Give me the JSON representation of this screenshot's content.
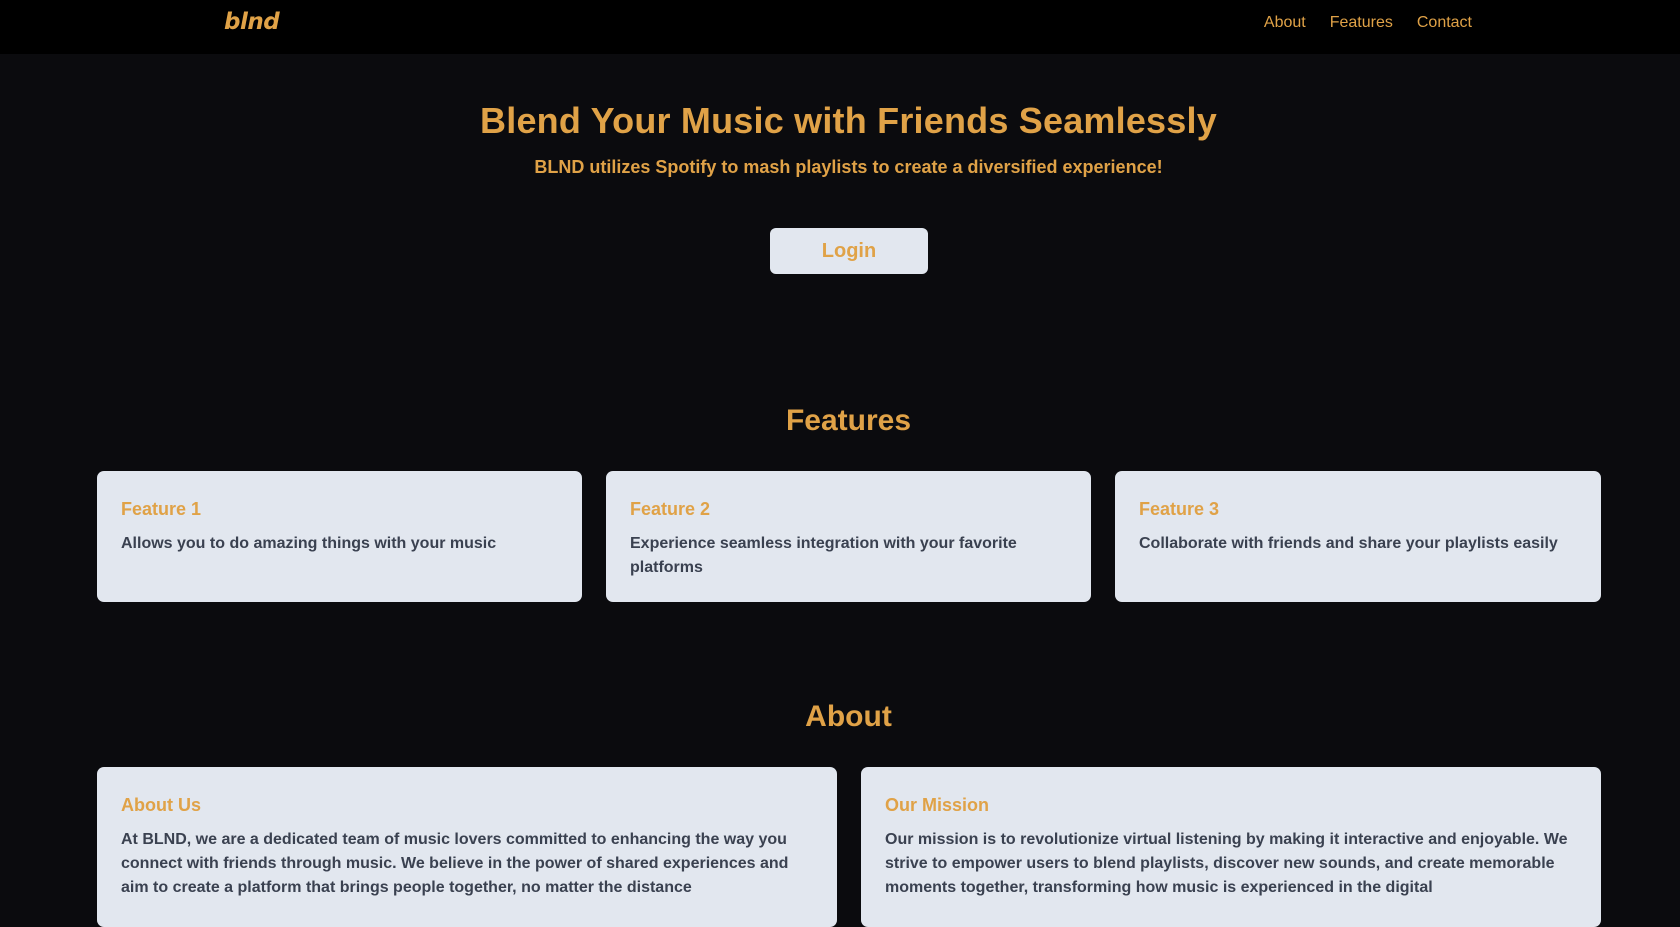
{
  "brand": {
    "logo_text": "blnd",
    "accent_color": "#e0a247"
  },
  "nav": {
    "links": [
      {
        "label": "About"
      },
      {
        "label": "Features"
      },
      {
        "label": "Contact"
      }
    ]
  },
  "hero": {
    "title": "Blend Your Music with Friends Seamlessly",
    "subtitle": "BLND utilizes Spotify to mash playlists to create a diversified experience!",
    "login_label": "Login"
  },
  "features": {
    "heading": "Features",
    "cards": [
      {
        "title": "Feature 1",
        "text": "Allows you to do amazing things with your music"
      },
      {
        "title": "Feature 2",
        "text": "Experience seamless integration with your favorite platforms"
      },
      {
        "title": "Feature 3",
        "text": "Collaborate with friends and share your playlists easily"
      }
    ]
  },
  "about": {
    "heading": "About",
    "cards": [
      {
        "title": "About Us",
        "text": "At BLND, we are a dedicated team of music lovers committed to enhancing the way you connect with friends through music. We believe in the power of shared experiences and aim to create a platform that brings people together, no matter the distance"
      },
      {
        "title": "Our Mission",
        "text": "Our mission is to revolutionize virtual listening by making it interactive and enjoyable. We strive to empower users to blend playlists, discover new sounds, and create memorable moments together, transforming how music is experienced in the digital"
      }
    ]
  }
}
